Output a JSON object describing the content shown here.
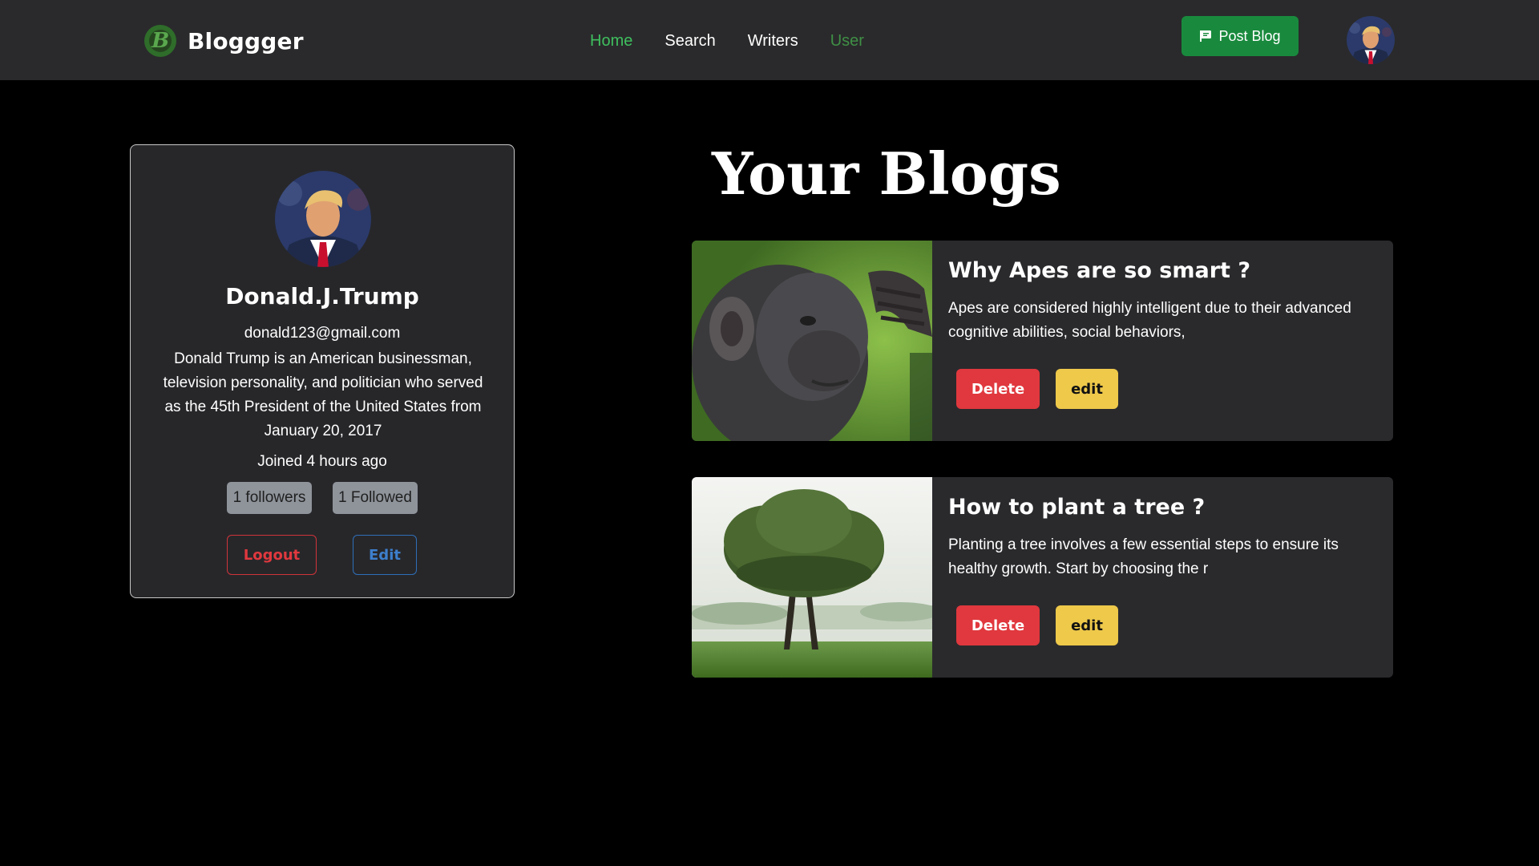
{
  "brand": {
    "name": "Bloggger",
    "logo_letter": "B"
  },
  "nav": {
    "links": [
      {
        "label": "Home",
        "state": "active"
      },
      {
        "label": "Search",
        "state": "default"
      },
      {
        "label": "Writers",
        "state": "default"
      },
      {
        "label": "User",
        "state": "current"
      }
    ],
    "post_blog_label": "Post Blog"
  },
  "profile": {
    "name": "Donald.J.Trump",
    "email": "donald123@gmail.com",
    "bio": "Donald Trump is an American businessman, television personality, and politician who served as the 45th President of the United States from January 20, 2017",
    "joined": "Joined 4 hours ago",
    "followers": "1 followers",
    "followed": "1 Followed",
    "logout_label": "Logout",
    "edit_label": "Edit"
  },
  "blogs_section": {
    "heading": "Your Blogs",
    "posts": [
      {
        "title": "Why Apes are so smart ?",
        "excerpt": "Apes are considered highly intelligent due to their advanced cognitive abilities, social behaviors,",
        "delete_label": "Delete",
        "edit_label": "edit",
        "image": "ape-photo"
      },
      {
        "title": "How to plant a tree ?",
        "excerpt": "Planting a tree involves a few essential steps to ensure its healthy growth. Start by choosing the r",
        "delete_label": "Delete",
        "edit_label": "edit",
        "image": "tree-photo"
      }
    ]
  },
  "colors": {
    "navbar_bg": "#2a2a2c",
    "page_bg": "#000000",
    "card_bg": "#27272a",
    "accent_green": "#198a3d",
    "nav_active": "#3fbf5e",
    "delete_red": "#e0383e",
    "edit_yellow": "#eec94a",
    "edit_blue": "#3d7fcc",
    "chip_gray": "#8f949b"
  }
}
